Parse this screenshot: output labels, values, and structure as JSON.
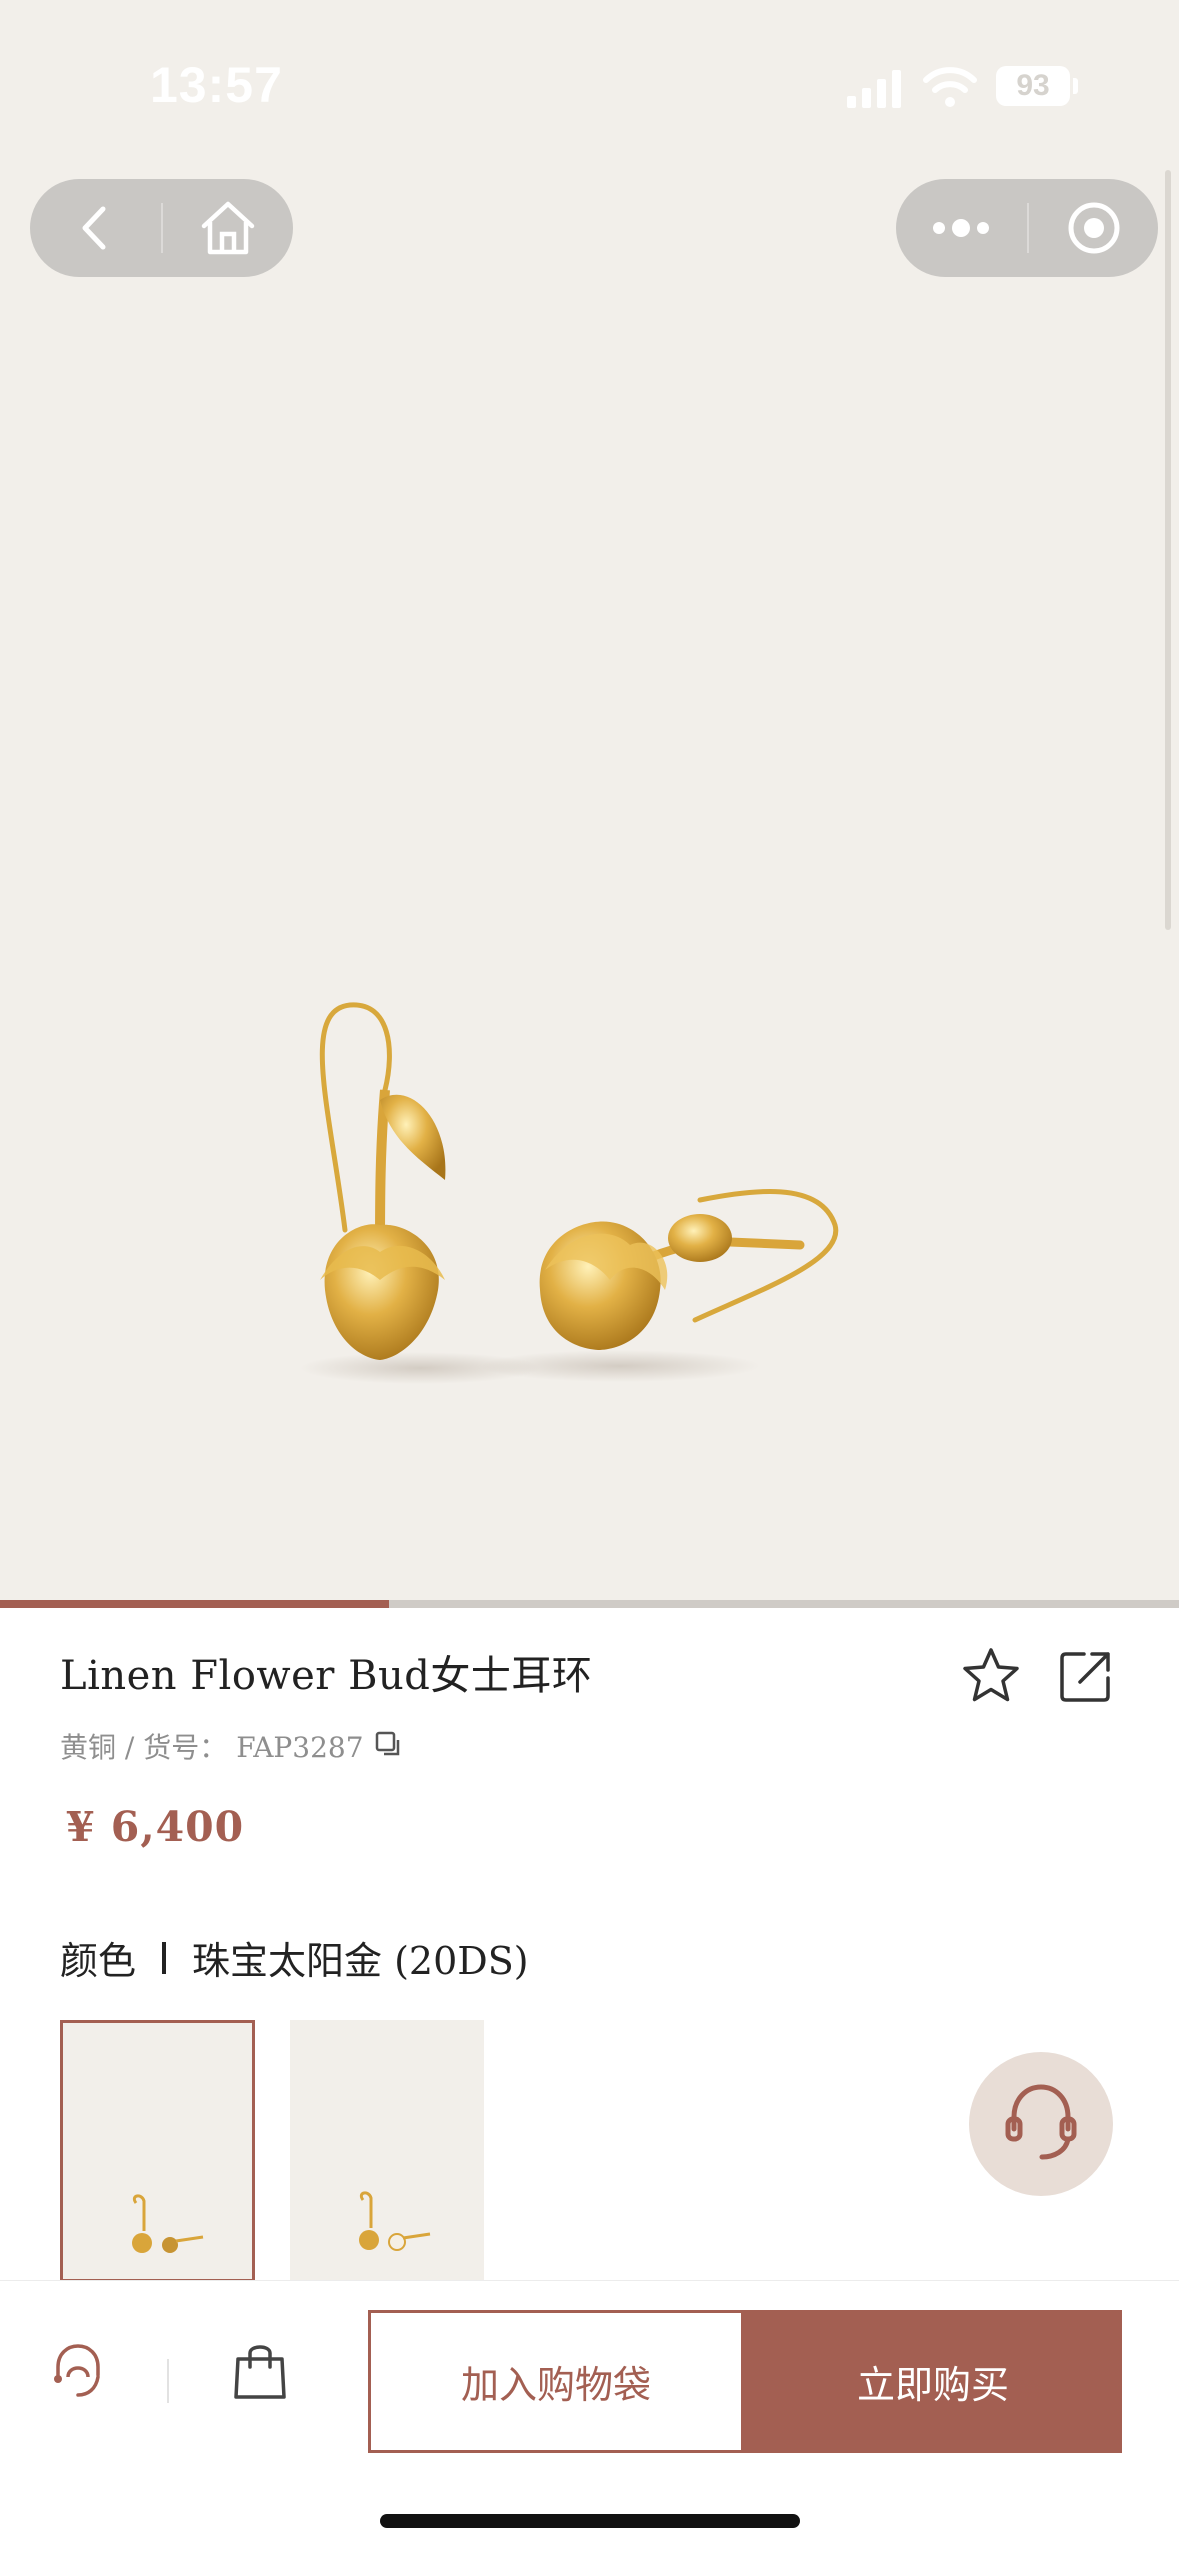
{
  "status_bar": {
    "time": "13:57",
    "battery": "93"
  },
  "product": {
    "title": "Linen Flower Bud女士耳环",
    "material": "黄铜",
    "sku_label": "货号",
    "sku": "FAP3287",
    "price": "¥ 6,400"
  },
  "color": {
    "label": "颜色",
    "selected": "珠宝太阳金 (20DS)",
    "swatch_count": 2
  },
  "carousel": {
    "progress": 0.33
  },
  "actions": {
    "add_to_cart": "加入购物袋",
    "buy_now": "立即购买"
  },
  "theme": {
    "accent": "#a35f52",
    "hero_bg": "#f2efea",
    "gold": "#d9a53a"
  },
  "icons": {
    "back": "chevron-left-icon",
    "home": "home-icon",
    "more": "more-dots-icon",
    "close": "close-target-icon",
    "favorite": "star-icon",
    "share": "share-icon",
    "copy": "copy-icon",
    "service": "headset-icon",
    "bag": "shopping-bag-icon"
  }
}
